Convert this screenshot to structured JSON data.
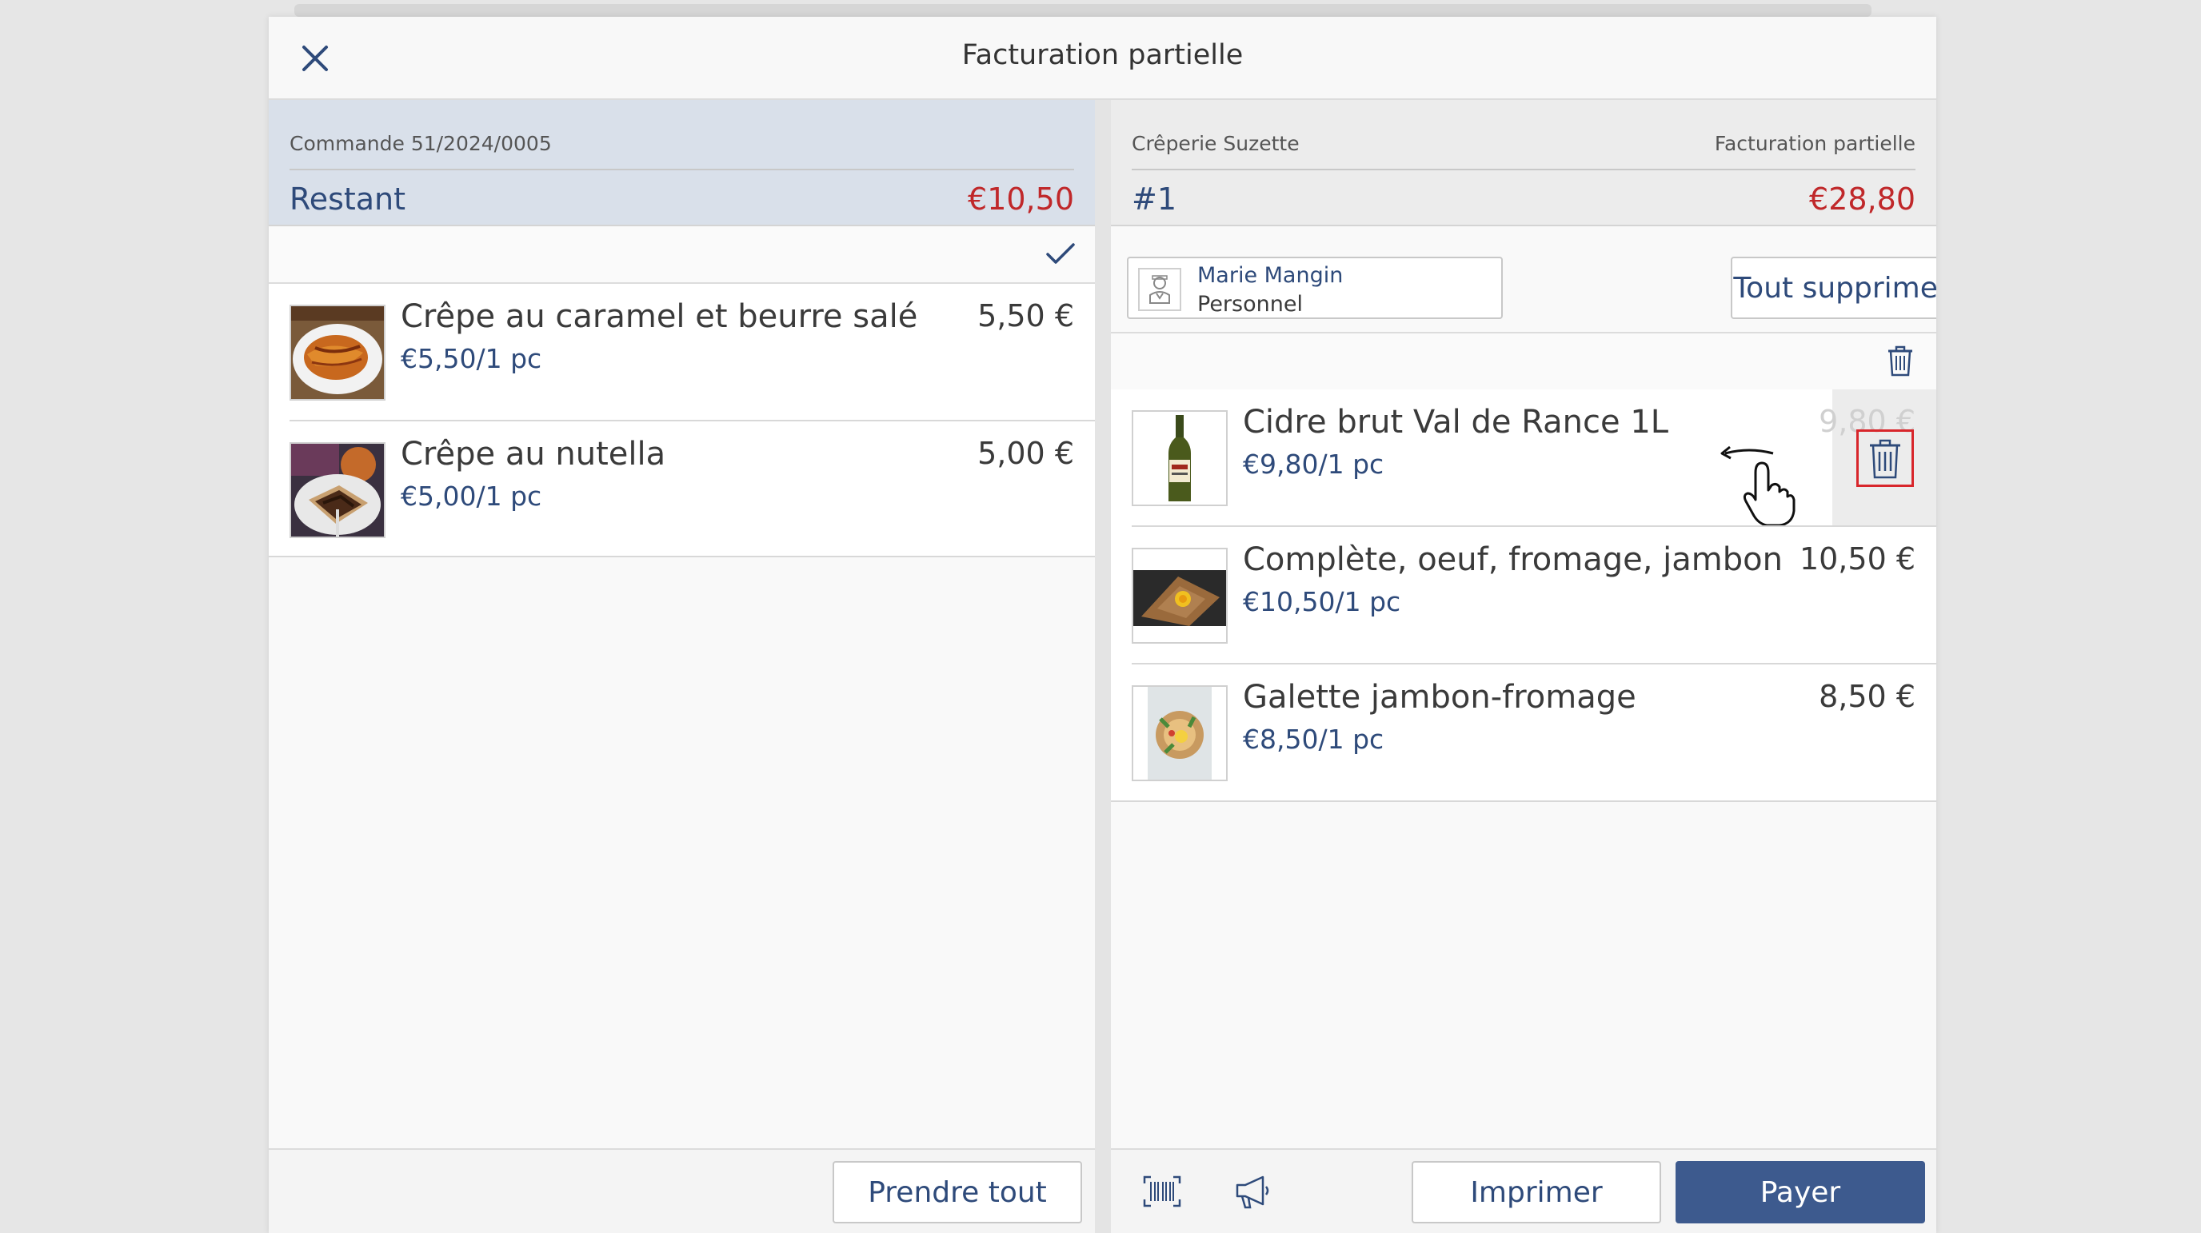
{
  "header": {
    "title": "Facturation partielle"
  },
  "left": {
    "order_label": "Commande 51/2024/0005",
    "remaining_label": "Restant",
    "remaining_amount": "€10,50",
    "items": [
      {
        "name": "Crêpe au caramel et beurre salé",
        "unit_price": "€5,50/1 pc",
        "price": "5,50 €",
        "icon": "crepe-caramel-photo"
      },
      {
        "name": "Crêpe au nutella",
        "unit_price": "€5,00/1 pc",
        "price": "5,00 €",
        "icon": "crepe-nutella-photo"
      }
    ],
    "take_all_label": "Prendre tout"
  },
  "right": {
    "restaurant_name": "Crêperie Suzette",
    "mode_label": "Facturation partielle",
    "invoice_number": "#1",
    "total_amount": "€28,80",
    "staff": {
      "name": "Marie Mangin",
      "role": "Personnel"
    },
    "delete_all_label": "Tout supprimer",
    "items": [
      {
        "name": "Cidre brut Val de Rance 1L",
        "unit_price": "€9,80/1 pc",
        "price": "9,80 €",
        "icon": "cider-bottle-photo"
      },
      {
        "name": "Complète, oeuf, fromage, jambon",
        "unit_price": "€10,50/1 pc",
        "price": "10,50 €",
        "icon": "galette-complete-photo"
      },
      {
        "name": "Galette jambon-fromage",
        "unit_price": "€8,50/1 pc",
        "price": "8,50 €",
        "icon": "galette-jambon-photo"
      }
    ],
    "print_label": "Imprimer",
    "pay_label": "Payer"
  },
  "colors": {
    "accent_blue": "#3d5a8e",
    "text_blue": "#2e4a7a",
    "amount_red": "#c0282a",
    "delete_red": "#d8262b"
  }
}
